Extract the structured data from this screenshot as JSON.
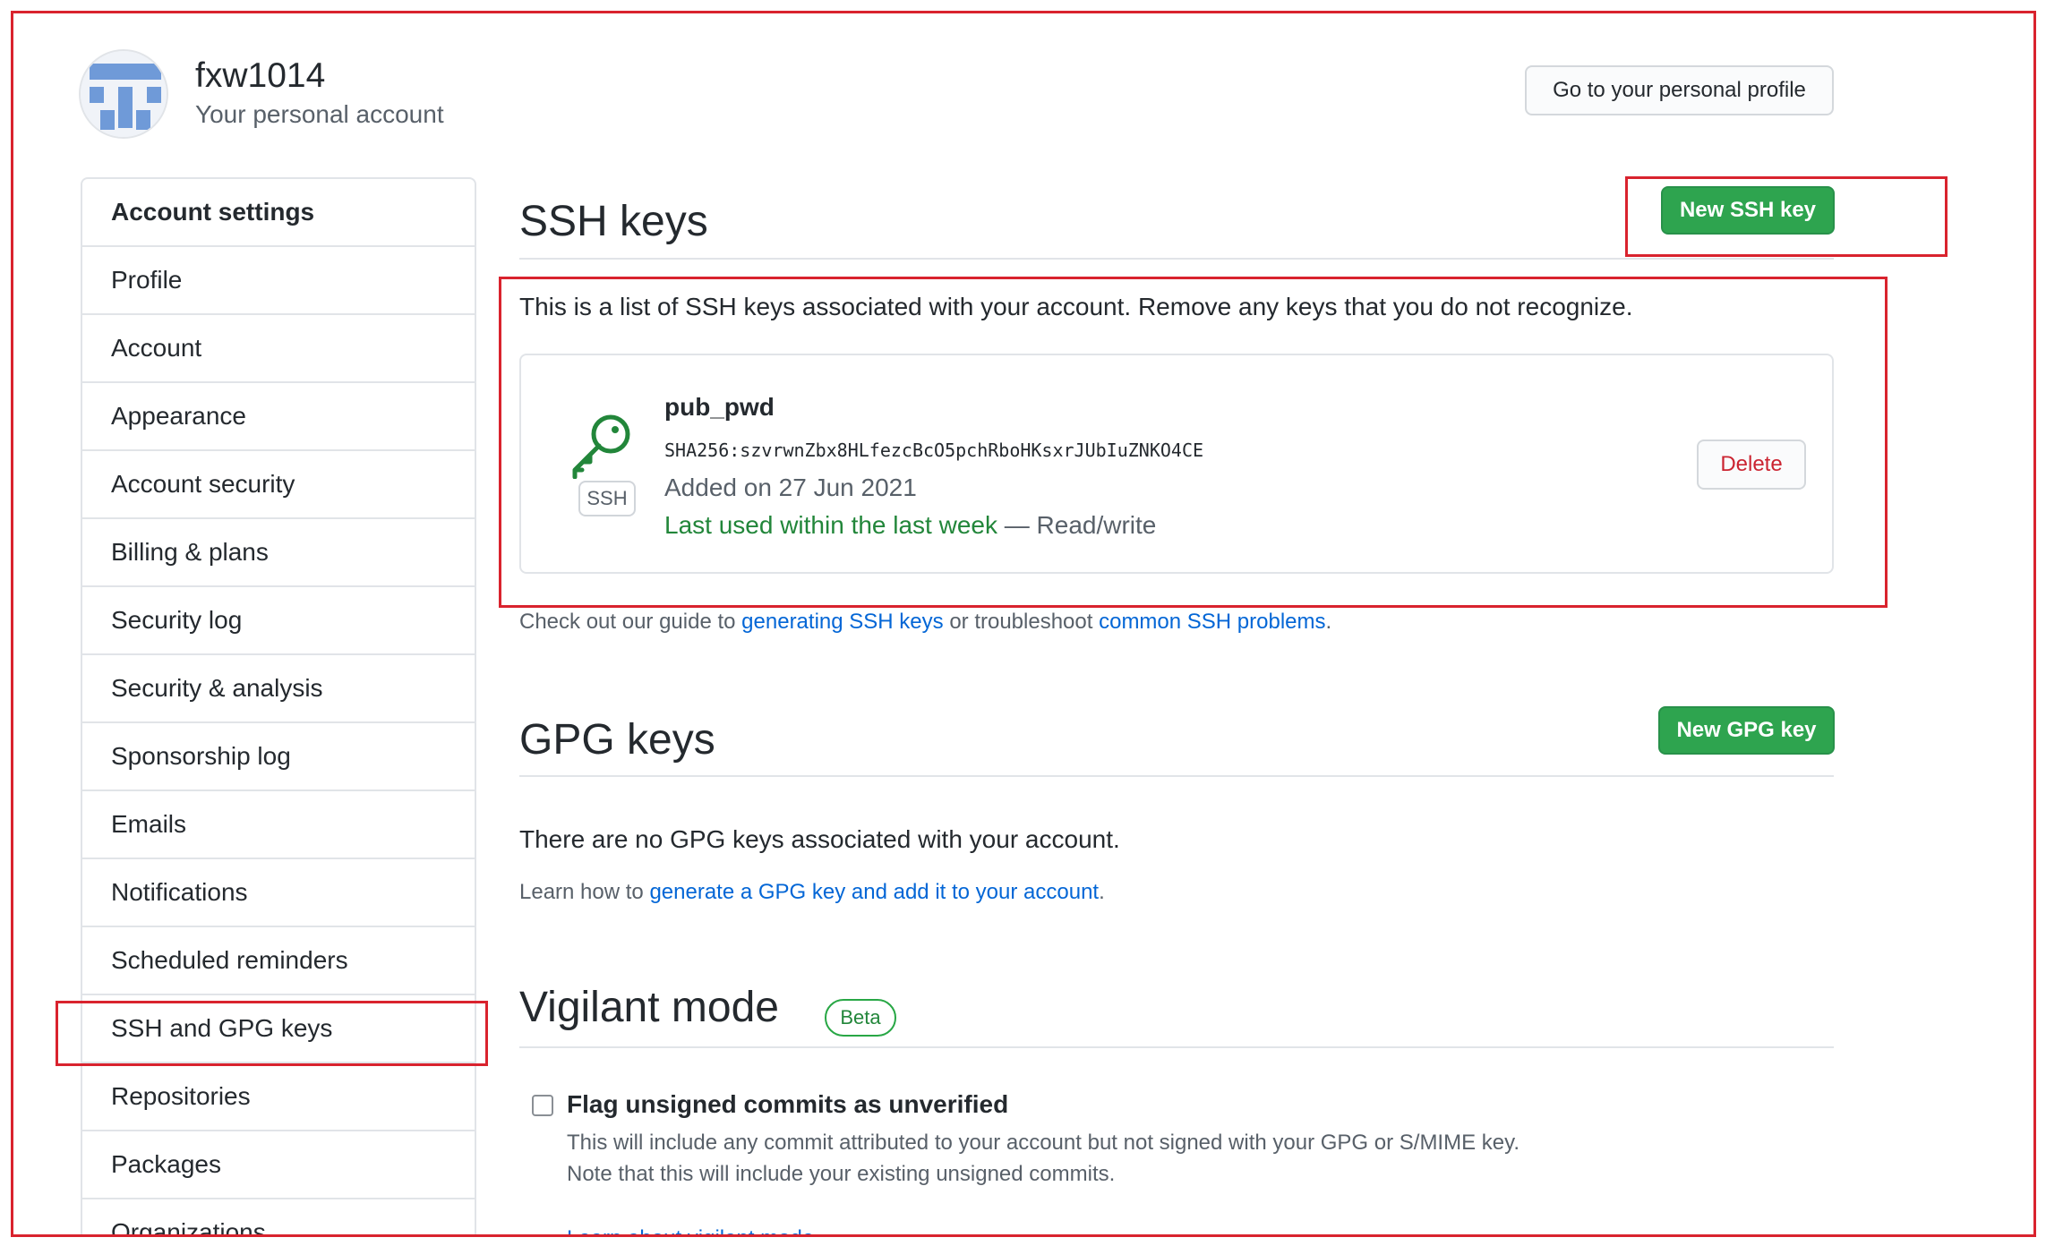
{
  "header": {
    "username": "fxw1014",
    "subtitle": "Your personal account",
    "profile_button": "Go to your personal profile"
  },
  "sidebar": {
    "title": "Account settings",
    "items": [
      {
        "label": "Profile"
      },
      {
        "label": "Account"
      },
      {
        "label": "Appearance"
      },
      {
        "label": "Account security"
      },
      {
        "label": "Billing & plans"
      },
      {
        "label": "Security log"
      },
      {
        "label": "Security & analysis"
      },
      {
        "label": "Sponsorship log"
      },
      {
        "label": "Emails"
      },
      {
        "label": "Notifications"
      },
      {
        "label": "Scheduled reminders"
      },
      {
        "label": "SSH and GPG keys"
      },
      {
        "label": "Repositories"
      },
      {
        "label": "Packages"
      },
      {
        "label": "Organizations"
      }
    ]
  },
  "ssh": {
    "title": "SSH keys",
    "new_button": "New SSH key",
    "description": "This is a list of SSH keys associated with your account. Remove any keys that you do not recognize.",
    "key": {
      "badge": "SSH",
      "name": "pub_pwd",
      "fingerprint": "SHA256:szvrwnZbx8HLfezcBcO5pchRboHKsxrJUbIuZNKO4CE",
      "added": "Added on 27 Jun 2021",
      "last_used": "Last used within the last week",
      "access": "— Read/write",
      "delete_button": "Delete"
    },
    "guide_prefix": "Check out our guide to",
    "guide_link1": "generating SSH keys",
    "guide_middle": "or troubleshoot",
    "guide_link2": "common SSH problems",
    "guide_suffix": "."
  },
  "gpg": {
    "title": "GPG keys",
    "new_button": "New GPG key",
    "empty": "There are no GPG keys associated with your account.",
    "learn_prefix": "Learn how to",
    "learn_link": "generate a GPG key and add it to your account",
    "learn_suffix": "."
  },
  "vigilant": {
    "title": "Vigilant mode",
    "badge": "Beta",
    "option_label": "Flag unsigned commits as unverified",
    "desc1": "This will include any commit attributed to your account but not signed with your GPG or S/MIME key.",
    "desc2": "Note that this will include your existing unsigned commits.",
    "learn_link": "Learn about vigilant mode."
  },
  "colors": {
    "annotation": "#d9232e",
    "primary_green": "#2ea44f",
    "link": "#0366d6",
    "danger": "#cb2431"
  },
  "icons": [
    "avatar-identicon",
    "key-icon",
    "checkbox-icon"
  ]
}
